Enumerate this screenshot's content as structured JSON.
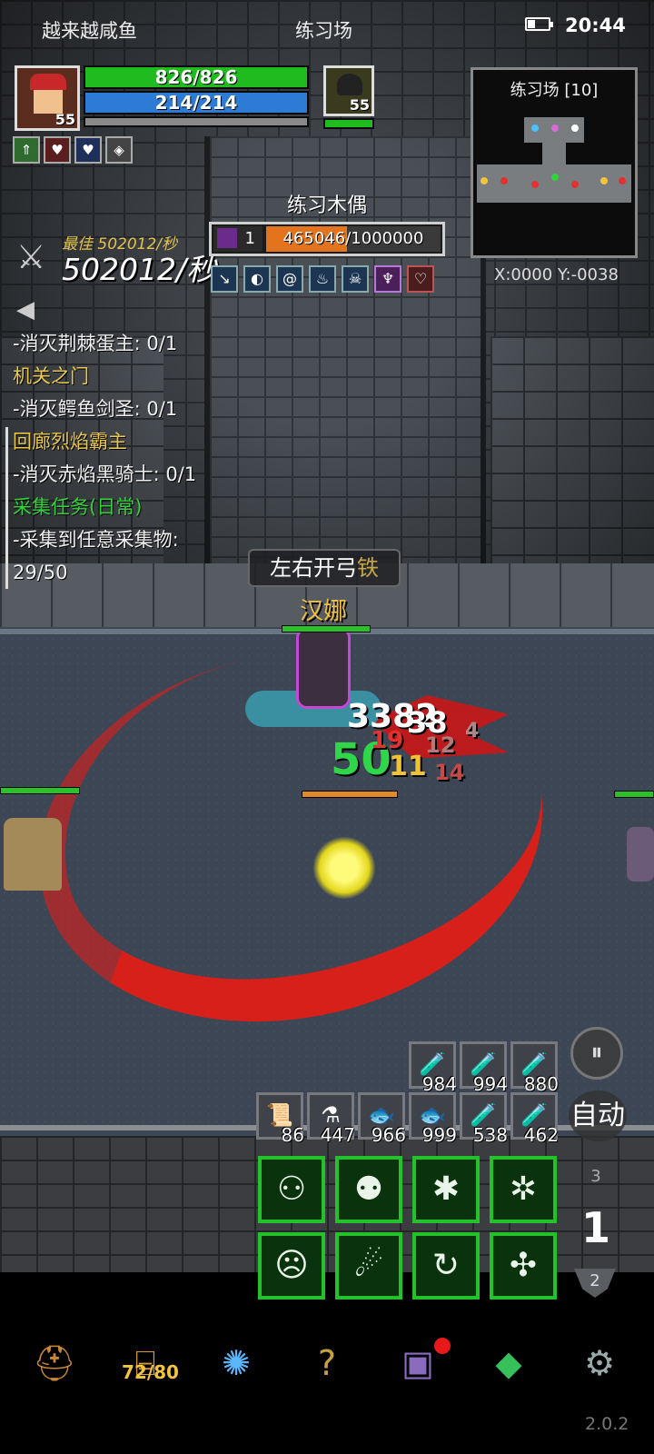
{
  "status_bar": {
    "left_text": "越来越咸鱼",
    "center_text": "练习场",
    "time": "20:44"
  },
  "player": {
    "level": "55",
    "hp": "826/826",
    "mp": "214/214",
    "buffs": [
      "arrow-up-buff-icon",
      "heart-up-buff-icon",
      "mana-up-buff-icon",
      "shield-up-buff-icon"
    ]
  },
  "pet": {
    "level": "55"
  },
  "target": {
    "name": "练习木偶",
    "level": "1",
    "hp_text": "465046/1000000",
    "hp_fraction": 0.465,
    "debuffs": [
      "sword-debuff-icon",
      "shield-break-icon",
      "vortex-icon",
      "flame-icon",
      "skull-icon",
      "demon-mark-icon",
      "wing-icon"
    ]
  },
  "dps": {
    "best": "最佳 502012/秒",
    "current": "502012/秒"
  },
  "quests": [
    {
      "text": "-消灭荆棘蛋主: 0/1",
      "kind": "item"
    },
    {
      "text": "机关之门",
      "kind": "title"
    },
    {
      "text": "-消灭鳄鱼剑圣: 0/1",
      "kind": "item"
    },
    {
      "text": "回廊烈焰霸主",
      "kind": "title"
    },
    {
      "text": "-消灭赤焰黑骑士: 0/1",
      "kind": "item"
    },
    {
      "text": "采集任务(日常)",
      "kind": "daily"
    },
    {
      "text": "-采集到任意采集物:",
      "kind": "item"
    },
    {
      "text": "29/50",
      "kind": "item"
    }
  ],
  "minimap": {
    "title": "练习场 [10]",
    "coords": "X:0000  Y:-0038"
  },
  "scene": {
    "skill_banner": "左右开弓",
    "skill_banner_suffix": "铁",
    "character_name": "汉娜",
    "damage_numbers": [
      "3382",
      "38",
      "50",
      "11",
      "19",
      "12",
      "14",
      "4"
    ]
  },
  "potions_top": [
    {
      "icon": "hp-potion-icon",
      "count": "984"
    },
    {
      "icon": "hp-potion-icon",
      "count": "994"
    },
    {
      "icon": "hp-potion-icon",
      "count": "880"
    }
  ],
  "potions_bottom": [
    {
      "icon": "scroll-icon",
      "count": "86"
    },
    {
      "icon": "mp-potion-icon",
      "count": "447"
    },
    {
      "icon": "fish-icon",
      "count": "966"
    },
    {
      "icon": "fish-icon",
      "count": "999"
    },
    {
      "icon": "hp-potion-icon",
      "count": "538"
    },
    {
      "icon": "hp-potion-icon",
      "count": "462"
    }
  ],
  "skills": [
    "summon-twins-skill-icon",
    "crab-skill-icon",
    "beetle-skill-icon",
    "spider-skill-icon",
    "demon-face-skill-icon",
    "wind-rush-skill-icon",
    "swirl-skill-icon",
    "bug-claw-skill-icon"
  ],
  "controls": {
    "auto_label": "自动",
    "page_up": "3",
    "page_current": "1",
    "page_down": "2"
  },
  "nav": {
    "bag_count": "72/80"
  },
  "version": "2.0.2"
}
